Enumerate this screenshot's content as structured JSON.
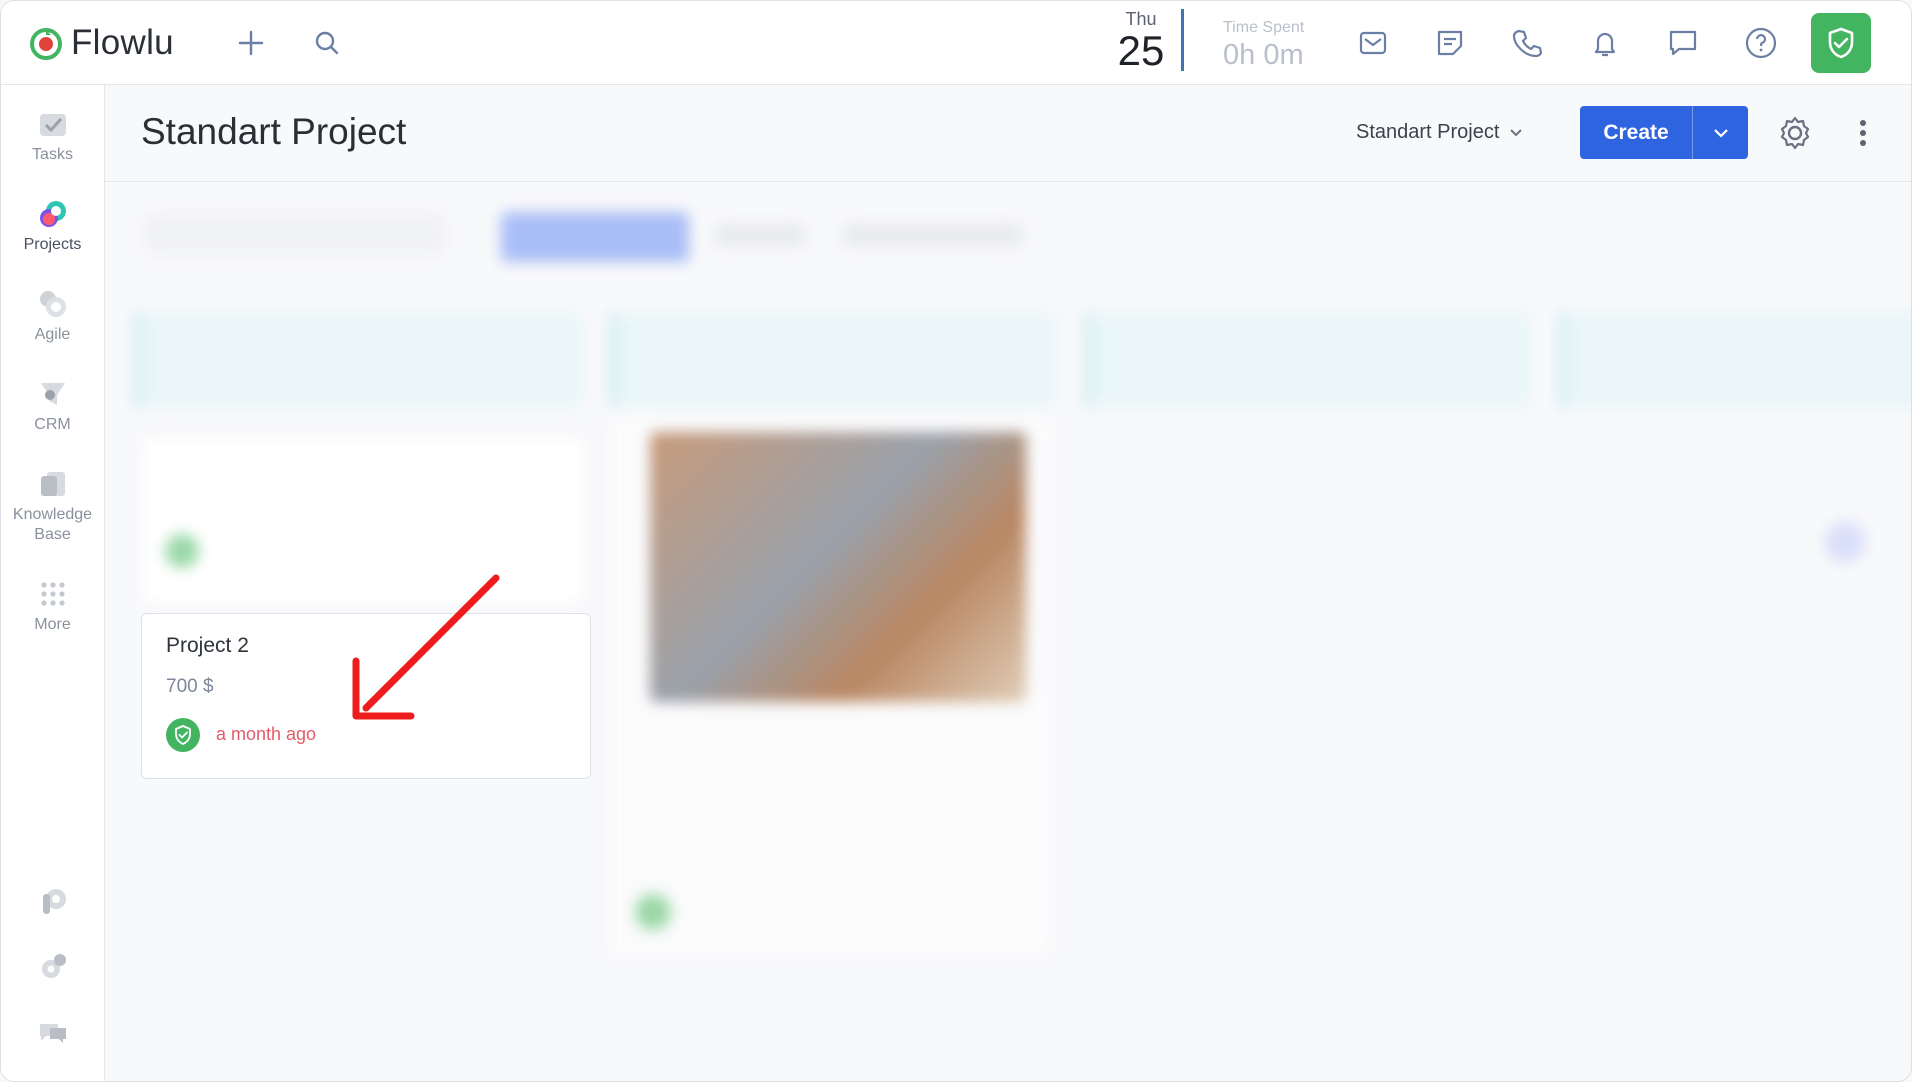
{
  "app": {
    "name": "Flowlu"
  },
  "topbar": {
    "date_day": "Thu",
    "date_num": "25",
    "time_spent_label": "Time Spent",
    "time_spent_value": "0h 0m",
    "icons": [
      "plus-icon",
      "search-icon",
      "mail-icon",
      "notes-icon",
      "phone-icon",
      "bell-icon",
      "chat-icon",
      "help-icon",
      "user-check-icon"
    ]
  },
  "sidebar": {
    "items": [
      {
        "label": "Tasks",
        "icon": "tasks-icon"
      },
      {
        "label": "Projects",
        "icon": "projects-icon"
      },
      {
        "label": "Agile",
        "icon": "agile-icon"
      },
      {
        "label": "CRM",
        "icon": "crm-icon"
      },
      {
        "label": "Knowledge Base",
        "icon": "knowledge-base-icon"
      },
      {
        "label": "More",
        "icon": "more-grid-icon"
      }
    ],
    "bottom_icons": [
      "p-icon",
      "settings-icon",
      "support-chat-icon"
    ]
  },
  "page": {
    "title": "Standart Project",
    "pipeline_select": "Standart Project",
    "create_label": "Create"
  },
  "card": {
    "title": "Project 2",
    "amount": "700 $",
    "time": "a month ago"
  },
  "colors": {
    "accent": "#2f64e1",
    "success": "#43b561",
    "overdue": "#e35b6a",
    "annotation_arrow": "#ee1c1c"
  }
}
